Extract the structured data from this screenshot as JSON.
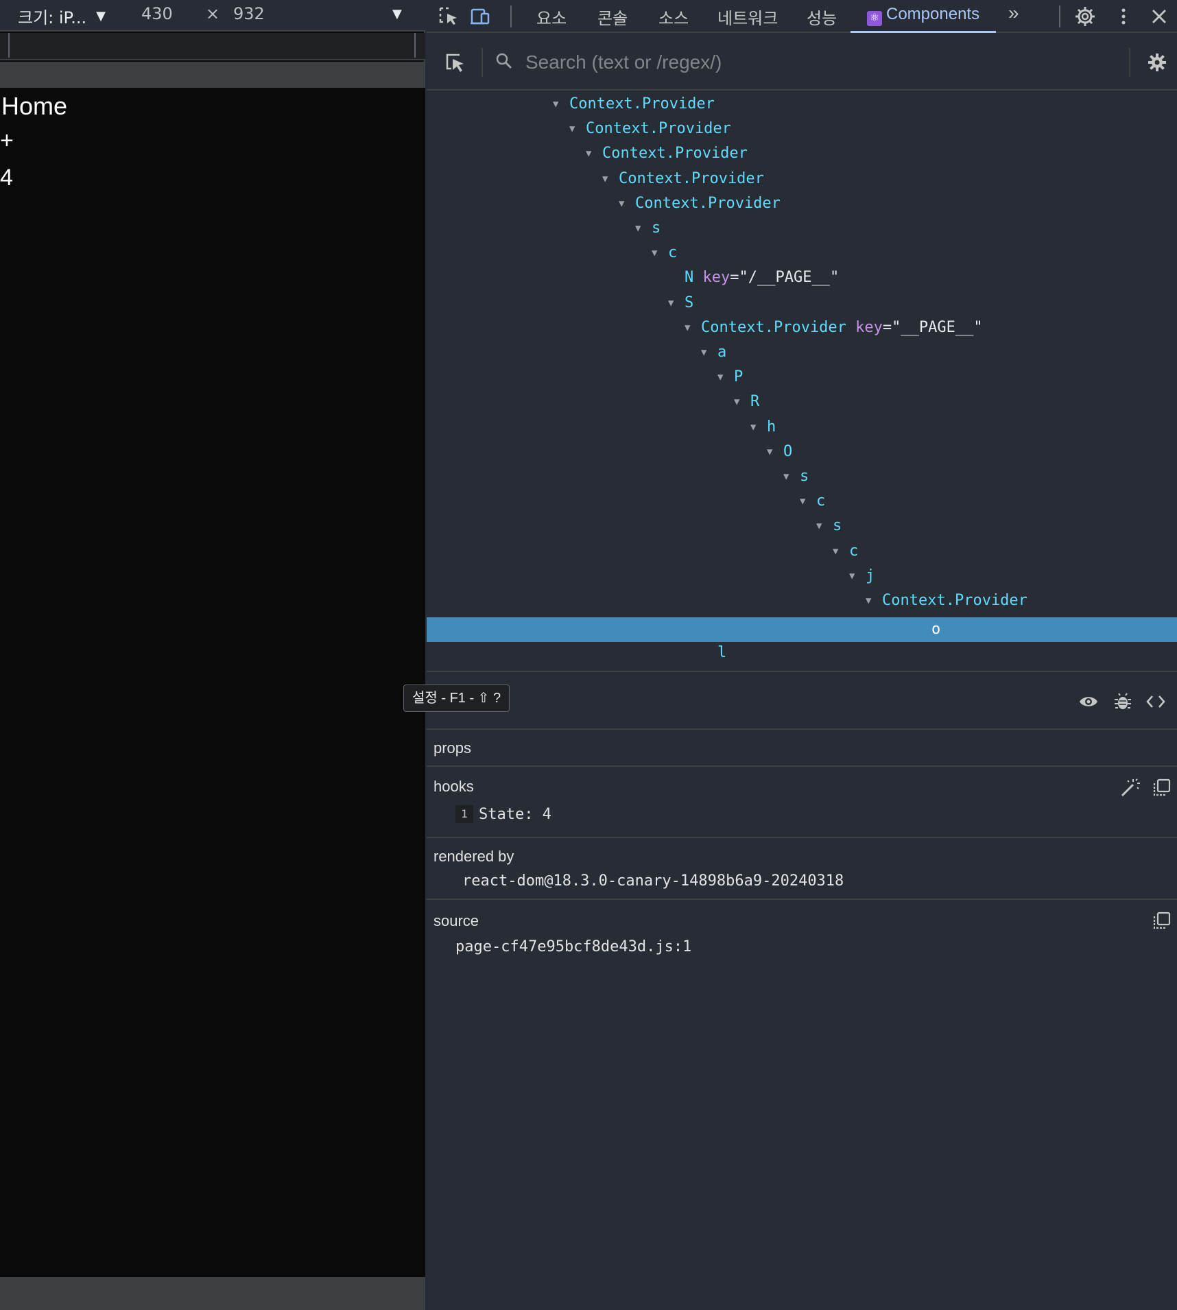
{
  "device_toolbar": {
    "device_label": "크기: iP...",
    "width": "430",
    "times": "×",
    "height": "932"
  },
  "viewport": {
    "title": "Home",
    "plus": "+",
    "count": "4"
  },
  "devtools": {
    "tabs": [
      {
        "label": "요소"
      },
      {
        "label": "콘솔"
      },
      {
        "label": "소스"
      },
      {
        "label": "네트워크"
      },
      {
        "label": "성능"
      },
      {
        "label": "Components"
      }
    ],
    "more_tabs": "»",
    "search": {
      "placeholder": "Search (text or /regex/)"
    },
    "tree": [
      {
        "name": "Context.Provider",
        "key": ""
      },
      {
        "name": "Context.Provider",
        "key": ""
      },
      {
        "name": "Context.Provider",
        "key": ""
      },
      {
        "name": "Context.Provider",
        "key": ""
      },
      {
        "name": "Context.Provider",
        "key": ""
      },
      {
        "name": "s",
        "key": ""
      },
      {
        "name": "c",
        "key": ""
      },
      {
        "name": "N",
        "key": "/__PAGE__"
      },
      {
        "name": "S",
        "key": ""
      },
      {
        "name": "Context.Provider",
        "key": "__PAGE__"
      },
      {
        "name": "a",
        "key": ""
      },
      {
        "name": "P",
        "key": ""
      },
      {
        "name": "R",
        "key": ""
      },
      {
        "name": "h",
        "key": ""
      },
      {
        "name": "O",
        "key": ""
      },
      {
        "name": "s",
        "key": ""
      },
      {
        "name": "c",
        "key": ""
      },
      {
        "name": "s",
        "key": ""
      },
      {
        "name": "c",
        "key": ""
      },
      {
        "name": "j",
        "key": ""
      },
      {
        "name": "Context.Provider",
        "key": ""
      },
      {
        "name": "o",
        "key": ""
      },
      {
        "name": "l",
        "key": ""
      }
    ],
    "key_attr": "key",
    "selected_component": "o",
    "tooltip": "설정 - F1 - ⇧ ?",
    "inspector": {
      "props_title": "props",
      "hooks_title": "hooks",
      "hook_index": "1",
      "hook_name": "State:",
      "hook_value": "4",
      "rendered_by_title": "rendered by",
      "rendered_by_value": "react-dom@18.3.0-canary-14898b6a9-20240318",
      "source_title": "source",
      "source_value": "page-cf47e95bcf8de43d.js:1"
    }
  }
}
